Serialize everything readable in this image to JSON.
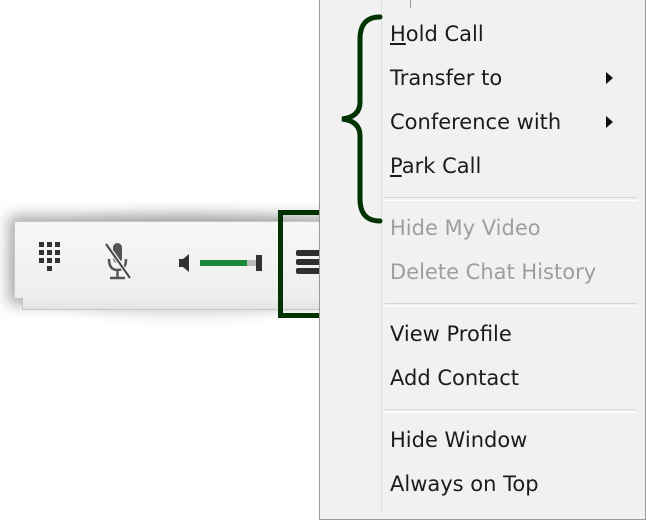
{
  "toolbar": {
    "buttons": [
      {
        "name": "dialpad",
        "icon": "dialpad-icon"
      },
      {
        "name": "mute",
        "icon": "microphone-muted-icon"
      },
      {
        "name": "volume",
        "icon": "speaker-icon",
        "level": 0.75
      },
      {
        "name": "more-options",
        "icon": "hamburger-menu-icon"
      }
    ]
  },
  "context_menu": {
    "groups": [
      [
        {
          "label": "Hold Call",
          "mnemonic_index": 0,
          "submenu": false,
          "enabled": true
        },
        {
          "label": "Transfer to",
          "submenu": true,
          "enabled": true
        },
        {
          "label": "Conference with",
          "submenu": true,
          "enabled": true
        },
        {
          "label": "Park Call",
          "mnemonic_index": 0,
          "submenu": false,
          "enabled": true
        }
      ],
      [
        {
          "label": "Hide My Video",
          "submenu": false,
          "enabled": false
        },
        {
          "label": "Delete Chat History",
          "submenu": false,
          "enabled": false
        }
      ],
      [
        {
          "label": "View Profile",
          "submenu": false,
          "enabled": true
        },
        {
          "label": "Add Contact",
          "submenu": false,
          "enabled": true
        }
      ],
      [
        {
          "label": "Hide Window",
          "submenu": false,
          "enabled": true
        },
        {
          "label": "Always on Top",
          "submenu": false,
          "enabled": true
        }
      ]
    ]
  },
  "colors": {
    "annotation": "#003300",
    "volume_fill": "#1a8a3a",
    "menu_background": "#f1f1f1",
    "disabled_text": "#9e9e9e"
  }
}
